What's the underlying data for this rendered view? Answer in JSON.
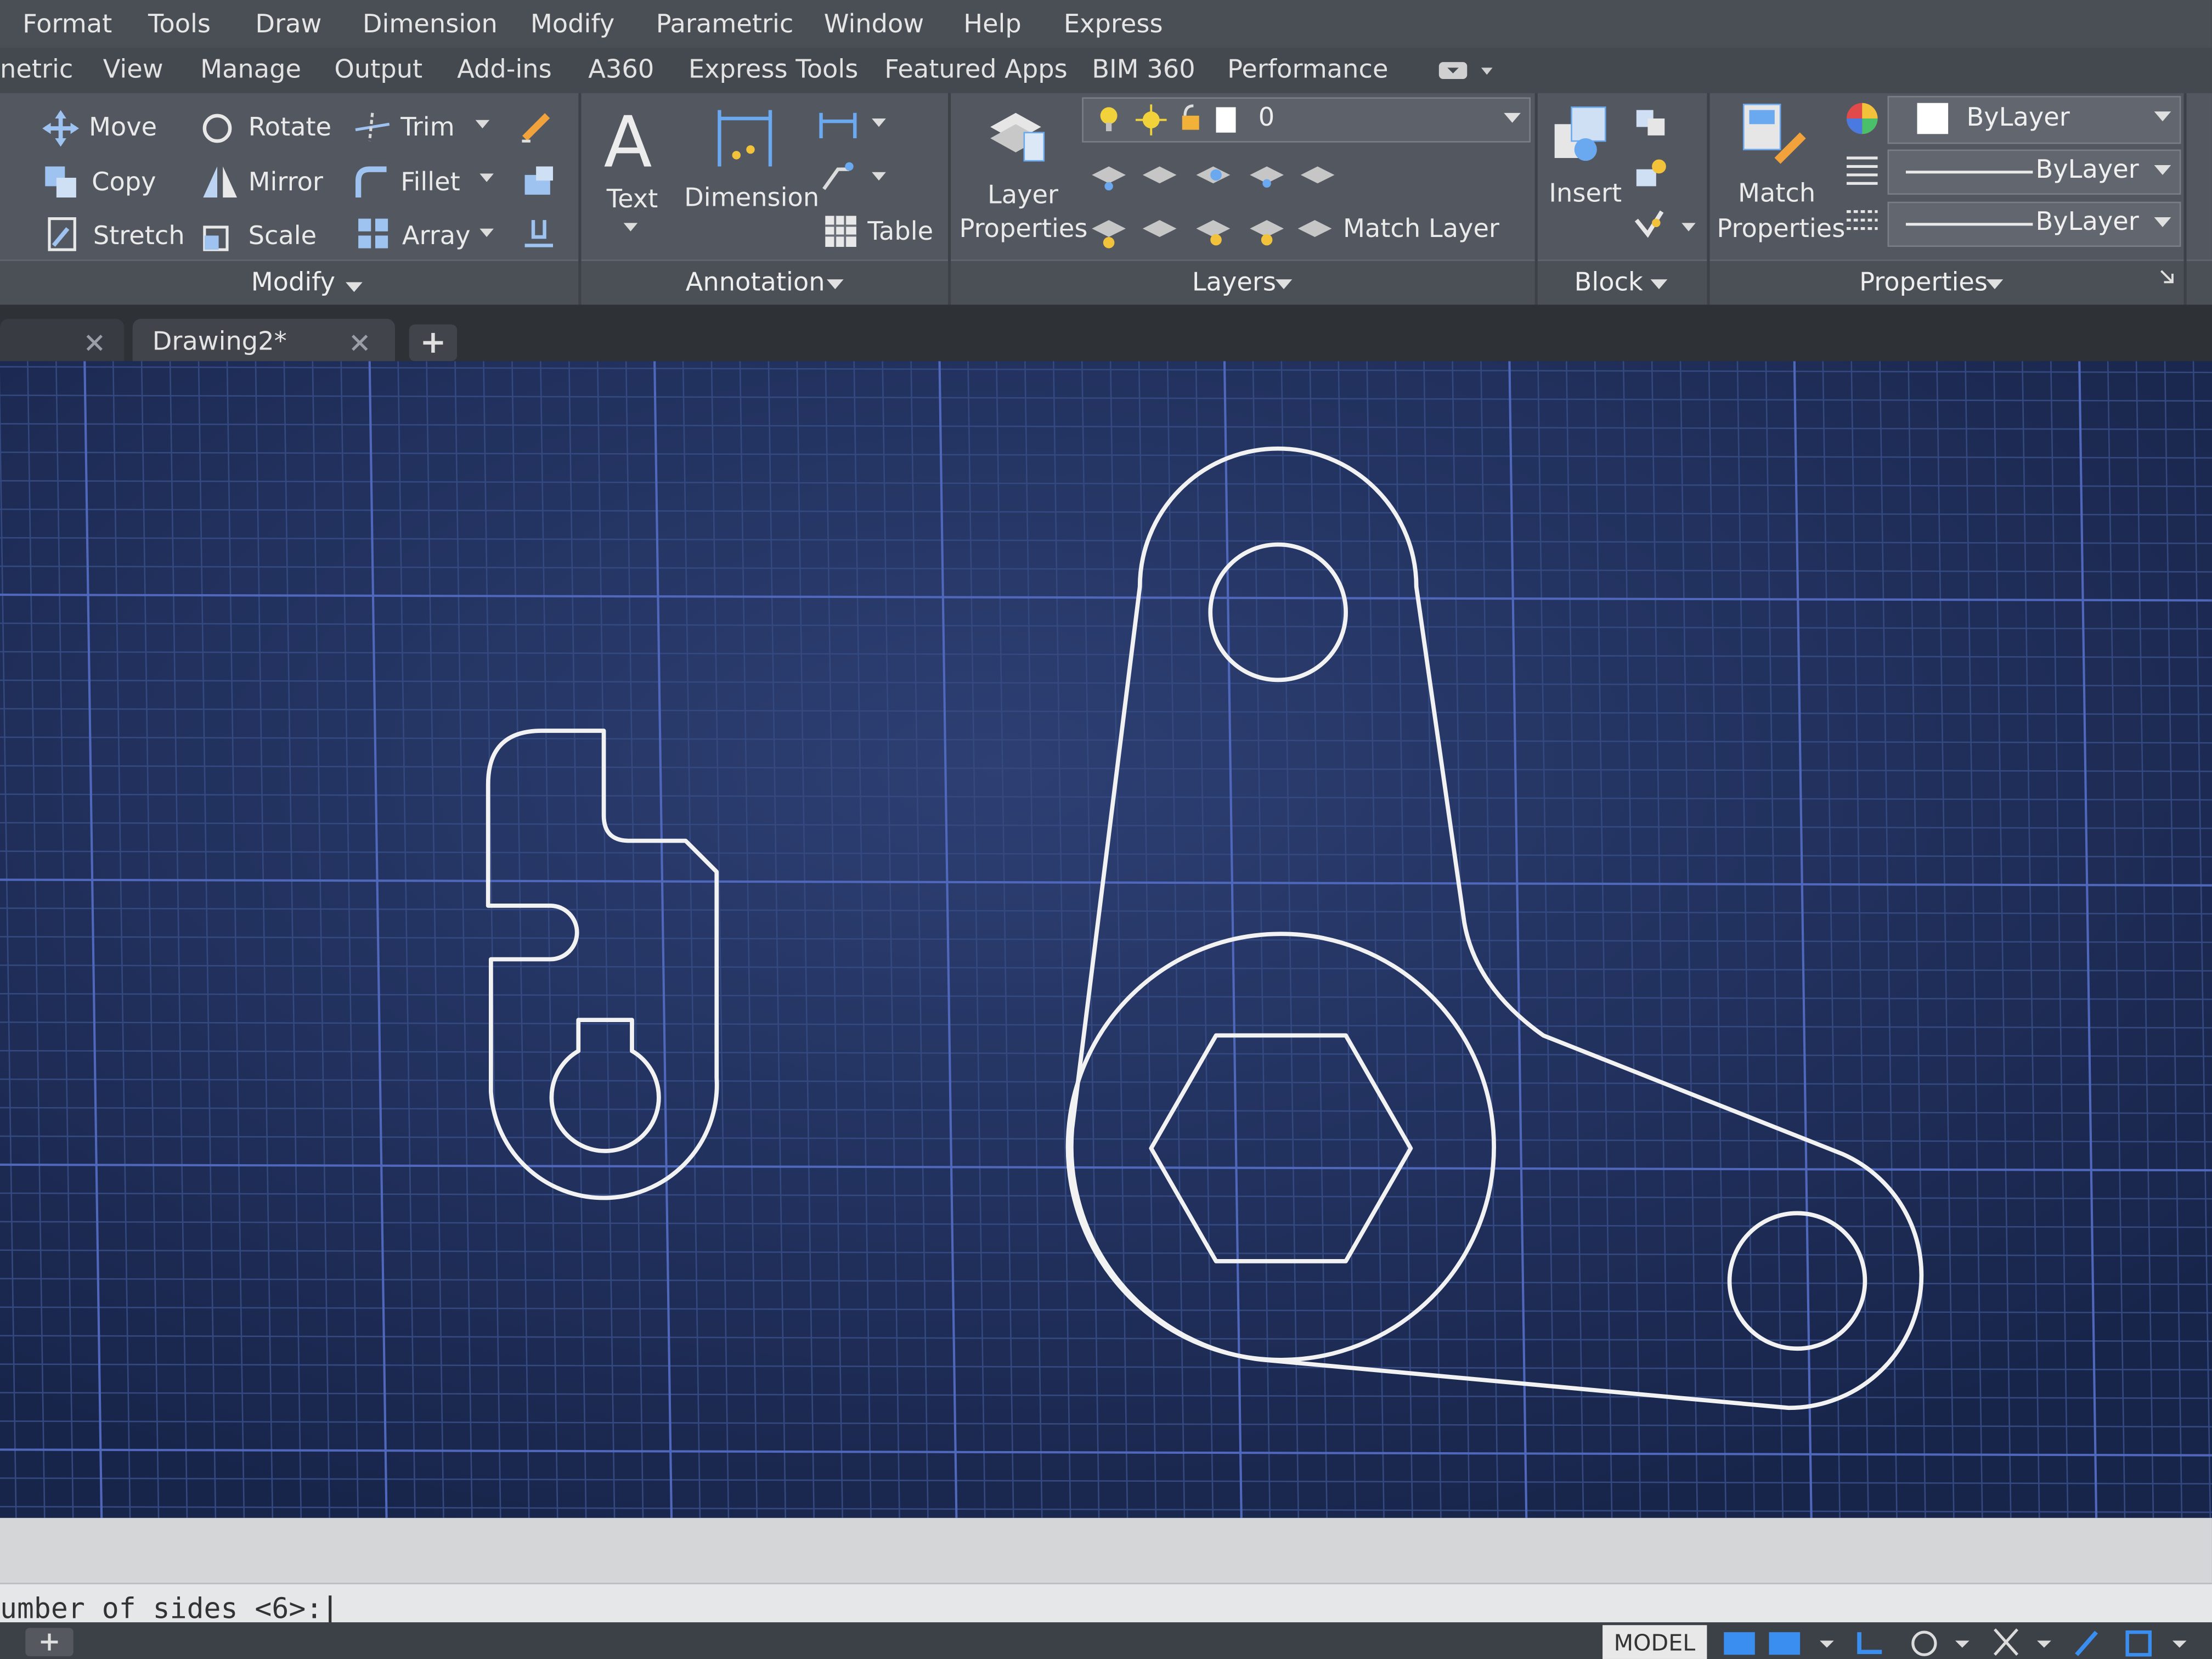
{
  "menu": [
    "Format",
    "Tools",
    "Draw",
    "Dimension",
    "Modify",
    "Parametric",
    "Window",
    "Help",
    "Express"
  ],
  "ribbon_tabs": [
    "netric",
    "View",
    "Manage",
    "Output",
    "Add-ins",
    "A360",
    "Express Tools",
    "Featured Apps",
    "BIM 360",
    "Performance"
  ],
  "modify": {
    "move": "Move",
    "rotate": "Rotate",
    "trim": "Trim",
    "copy": "Copy",
    "mirror": "Mirror",
    "fillet": "Fillet",
    "stretch": "Stretch",
    "scale": "Scale",
    "array": "Array",
    "title": "Modify"
  },
  "annotation": {
    "text": "Text",
    "dimension": "Dimension",
    "table": "Table",
    "title": "Annotation"
  },
  "layers": {
    "layer_props_1": "Layer",
    "layer_props_2": "Properties",
    "current_layer": "0",
    "match_layer": "Match Layer",
    "title": "Layers"
  },
  "block": {
    "insert": "Insert",
    "title": "Block"
  },
  "properties": {
    "match_1": "Match",
    "match_2": "Properties",
    "color": "ByLayer",
    "linetype": "ByLayer",
    "lineweight": "ByLayer",
    "title": "Properties"
  },
  "doc_tabs": {
    "active": "Drawing2*"
  },
  "command": {
    "prompt": "umber of sides <6>:"
  },
  "status": {
    "model": "MODEL"
  },
  "colors": {
    "canvas": "#1e2d5a",
    "grid_minor": "#2f4277",
    "grid_major": "#4c63b5",
    "geometry": "#f2f2f2"
  }
}
